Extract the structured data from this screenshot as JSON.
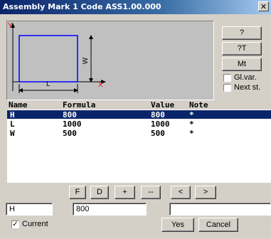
{
  "window": {
    "title": "Assembly Mark 1 Code ASS1.00.000",
    "close_label": "✕"
  },
  "preview": {
    "y_label": "Y",
    "x_label": "X",
    "w_label": "W",
    "l_label": "L"
  },
  "side_buttons": {
    "question": "?",
    "question_t": "?T",
    "mt": "Mt"
  },
  "side_checks": {
    "gl_var": "Gl.var.",
    "next_st": "Next st."
  },
  "table": {
    "headers": [
      "Name",
      "Formula",
      "Value",
      "Note"
    ],
    "rows": [
      {
        "name": "H",
        "formula": "800",
        "value": "800",
        "note": "*"
      },
      {
        "name": "L",
        "formula": "1000",
        "value": "1000",
        "note": "*"
      },
      {
        "name": "W",
        "formula": "500",
        "value": "500",
        "note": "*"
      }
    ],
    "selected_index": 0
  },
  "toolbar": {
    "f": "F",
    "d": "D",
    "plus": "+",
    "minus": "--",
    "left": "<",
    "right": ">"
  },
  "edit": {
    "name_value": "H",
    "formula_value": "800",
    "note_value": ""
  },
  "bottom": {
    "current_label": "Current",
    "current_checked": true,
    "yes_label": "Yes",
    "cancel_label": "Cancel"
  }
}
